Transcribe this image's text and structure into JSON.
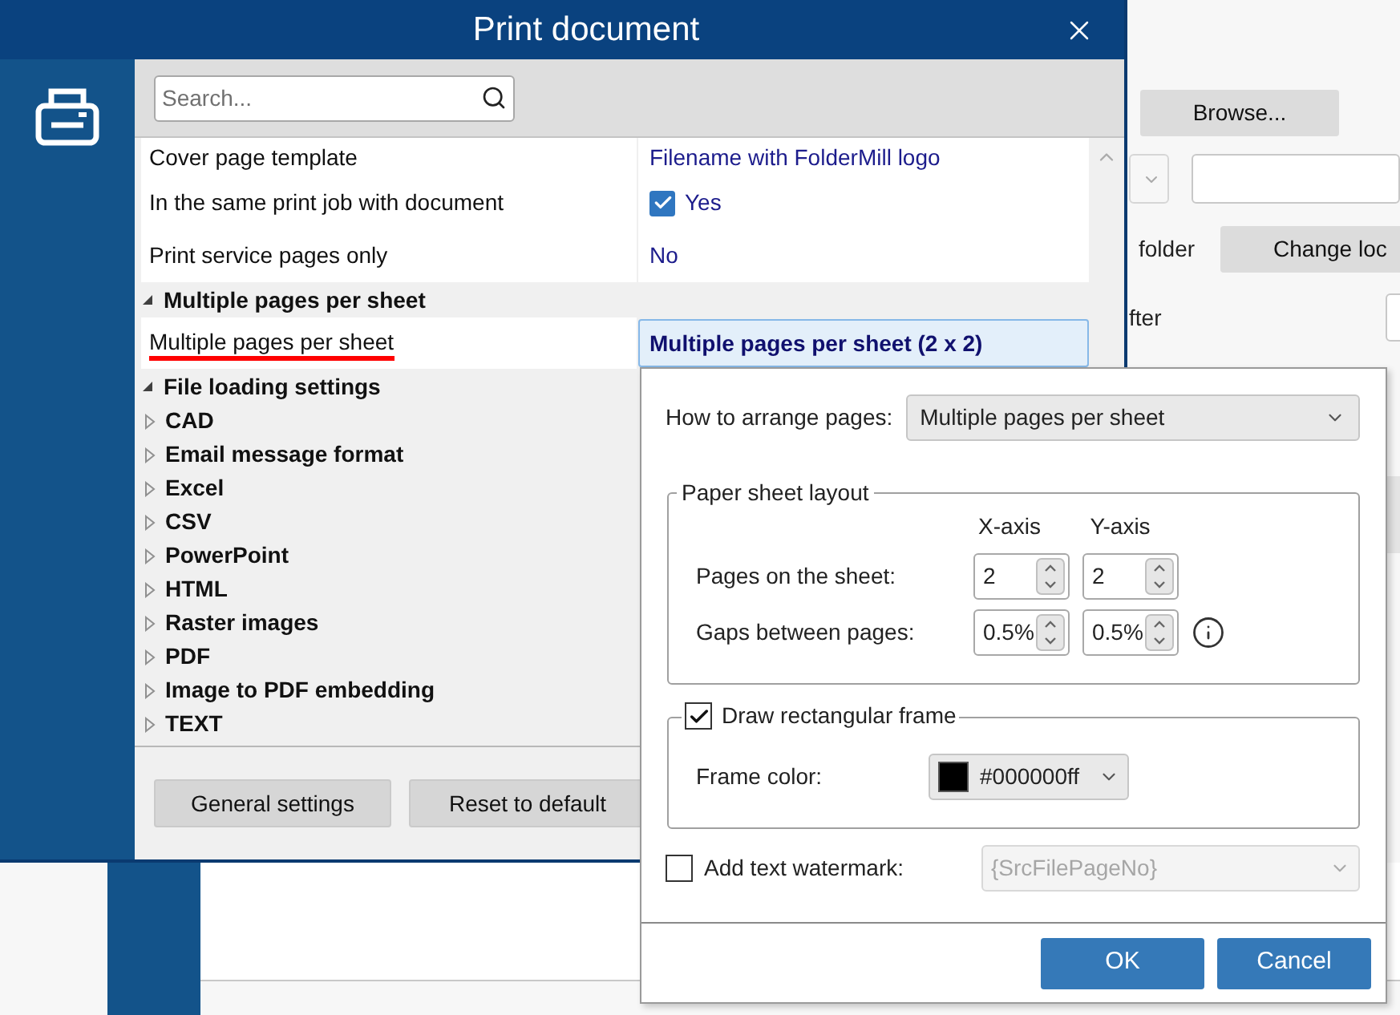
{
  "background_window": {
    "browse_button": "Browse...",
    "folder_label": "folder",
    "change_button": "Change loc",
    "after_label": "fter"
  },
  "window": {
    "title": "Print document"
  },
  "search": {
    "placeholder": "Search..."
  },
  "property_grid": {
    "rows": [
      {
        "kind": "text",
        "label": "Cover page template",
        "value": "Filename with FolderMill logo"
      },
      {
        "kind": "checkbox",
        "label": "In the same print job with document",
        "value": "Yes",
        "checked": true
      },
      {
        "kind": "text",
        "label": "Print service pages only",
        "value": "No"
      }
    ],
    "categories": [
      {
        "label": "Multiple pages per sheet",
        "expanded": true,
        "children": [
          {
            "label": "Multiple pages per sheet",
            "value": "Multiple pages per sheet (2 x 2)",
            "selected": true,
            "underlined": true
          }
        ]
      },
      {
        "label": "File loading settings",
        "expanded": true,
        "children": [
          {
            "label": "CAD",
            "expanded": false
          },
          {
            "label": "Email message format",
            "expanded": false
          },
          {
            "label": "Excel",
            "expanded": false
          },
          {
            "label": "CSV",
            "expanded": false
          },
          {
            "label": "PowerPoint",
            "expanded": false
          },
          {
            "label": "HTML",
            "expanded": false
          },
          {
            "label": "Raster images",
            "expanded": false
          },
          {
            "label": "PDF",
            "expanded": false
          },
          {
            "label": "Image to PDF embedding",
            "expanded": false
          },
          {
            "label": "TEXT",
            "expanded": false
          }
        ]
      }
    ]
  },
  "footer_buttons": [
    "General settings",
    "Reset to default"
  ],
  "popup": {
    "arrange": {
      "label": "How to arrange pages:",
      "value": "Multiple pages per sheet"
    },
    "layout": {
      "legend": "Paper sheet layout",
      "columns": [
        "X-axis",
        "Y-axis"
      ],
      "rows": [
        {
          "label": "Pages on the sheet:",
          "values": [
            "2",
            "2"
          ]
        },
        {
          "label": "Gaps between pages:",
          "values": [
            "0.5%",
            "0.5%"
          ],
          "info": true
        }
      ]
    },
    "frame": {
      "label": "Draw rectangular frame",
      "checked": true,
      "color_label": "Frame color:",
      "color_value": "#000000ff"
    },
    "watermark": {
      "label": "Add text watermark:",
      "checked": false,
      "value": "{SrcFilePageNo}",
      "disabled": true
    },
    "buttons": [
      "OK",
      "Cancel"
    ]
  }
}
